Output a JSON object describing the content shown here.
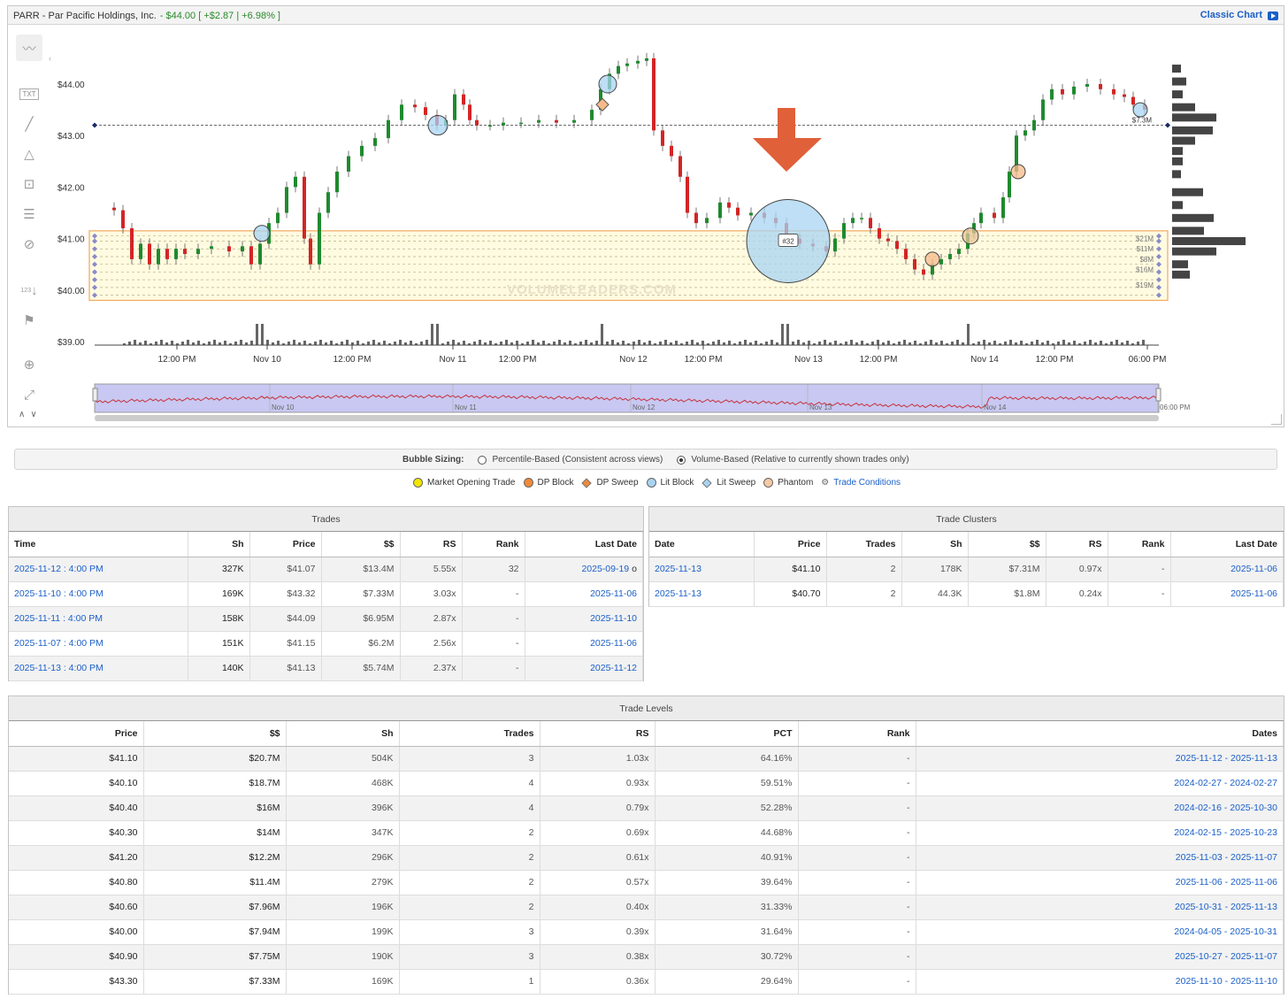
{
  "header": {
    "ticker": "PARR - Par Pacific Holdings, Inc.",
    "price_change": "- $44.00 [ +$2.87 | +6.98% ]",
    "classic_chart": "Classic Chart"
  },
  "toolbar": {
    "tools": [
      "trendline-tool",
      "text-tool",
      "line-tool",
      "fibonacci-tool",
      "rectangle-tool",
      "levels-tool",
      "hide-tool",
      "measure-tool",
      "flag-tool",
      "zoom-tool",
      "fit-tool"
    ],
    "text_tool_label": "TXT",
    "measure_label": "123"
  },
  "chart_data": {
    "type": "candlestick",
    "y_axis_ticks": [
      "$44.00",
      "$43.00",
      "$42.00",
      "$41.00",
      "$40.00",
      "$39.00"
    ],
    "ylim": [
      39.0,
      44.4
    ],
    "x_axis_ticks": [
      "12:00 PM",
      "Nov 10",
      "12:00 PM",
      "Nov 11",
      "12:00 PM",
      "Nov 12",
      "12:00 PM",
      "Nov 13",
      "12:00 PM",
      "Nov 14",
      "12:00 PM",
      "06:00 PM"
    ],
    "navigator_labels": [
      "Nov 10",
      "Nov 11",
      "Nov 12",
      "Nov 13",
      "Nov 14",
      "06:00 PM"
    ],
    "reference_line": {
      "price": 43.2,
      "label": "$7.3M"
    },
    "zone_labels": [
      "$21M",
      "$11M",
      "$8M",
      "$16M",
      "$19M"
    ],
    "bubble_label": "#32",
    "watermark": "VOLUMELEADERS.COM",
    "colors": {
      "up": "#1f8a2e",
      "down": "#d32525",
      "zone": "#fffbe0",
      "zone_border": "#f0a860",
      "arrow": "#e0603a",
      "lit_block": "#a8d4f2",
      "dp_block": "#f6b98a"
    }
  },
  "bubble_sizing": {
    "title": "Bubble Sizing:",
    "option1": "Percentile-Based (Consistent across views)",
    "option2": "Volume-Based (Relative to currently shown trades only)",
    "selected": "option2"
  },
  "legend": [
    {
      "label": "Market Opening Trade",
      "shape": "circle",
      "color": "#f2e600"
    },
    {
      "label": "DP Block",
      "shape": "circle",
      "color": "#f08a3a"
    },
    {
      "label": "DP Sweep",
      "shape": "diamond",
      "color": "#f08a3a"
    },
    {
      "label": "Lit Block",
      "shape": "circle",
      "color": "#a8d4f2"
    },
    {
      "label": "Lit Sweep",
      "shape": "diamond",
      "color": "#a8d4f2"
    },
    {
      "label": "Phantom",
      "shape": "circle",
      "color": "#f7c9a3"
    },
    {
      "label": "Trade Conditions",
      "shape": "gear",
      "color": "#1a5fc8"
    }
  ],
  "trades": {
    "title": "Trades",
    "columns": [
      "Time",
      "Sh",
      "Price",
      "$$",
      "RS",
      "Rank",
      "Last Date"
    ],
    "rows": [
      [
        "2025-11-12 : 4:00 PM",
        "327K",
        "$41.07",
        "$13.4M",
        "5.55x",
        "32",
        "2025-09-19",
        "o"
      ],
      [
        "2025-11-10 : 4:00 PM",
        "169K",
        "$43.32",
        "$7.33M",
        "3.03x",
        "-",
        "2025-11-06",
        ""
      ],
      [
        "2025-11-11 : 4:00 PM",
        "158K",
        "$44.09",
        "$6.95M",
        "2.87x",
        "-",
        "2025-11-10",
        ""
      ],
      [
        "2025-11-07 : 4:00 PM",
        "151K",
        "$41.15",
        "$6.2M",
        "2.56x",
        "-",
        "2025-11-06",
        ""
      ],
      [
        "2025-11-13 : 4:00 PM",
        "140K",
        "$41.13",
        "$5.74M",
        "2.37x",
        "-",
        "2025-11-12",
        ""
      ]
    ]
  },
  "clusters": {
    "title": "Trade Clusters",
    "columns": [
      "Date",
      "Price",
      "Trades",
      "Sh",
      "$$",
      "RS",
      "Rank",
      "Last Date"
    ],
    "rows": [
      [
        "2025-11-13",
        "$41.10",
        "2",
        "178K",
        "$7.31M",
        "0.97x",
        "-",
        "2025-11-06"
      ],
      [
        "2025-11-13",
        "$40.70",
        "2",
        "44.3K",
        "$1.8M",
        "0.24x",
        "-",
        "2025-11-06"
      ]
    ]
  },
  "levels": {
    "title": "Trade Levels",
    "columns": [
      "Price",
      "$$",
      "Sh",
      "Trades",
      "RS",
      "PCT",
      "Rank",
      "Dates"
    ],
    "rows": [
      [
        "$41.10",
        "$20.7M",
        "504K",
        "3",
        "1.03x",
        "64.16%",
        "-",
        "2025-11-12 - 2025-11-13"
      ],
      [
        "$40.10",
        "$18.7M",
        "468K",
        "4",
        "0.93x",
        "59.51%",
        "-",
        "2024-02-27 - 2024-02-27"
      ],
      [
        "$40.40",
        "$16M",
        "396K",
        "4",
        "0.79x",
        "52.28%",
        "-",
        "2024-02-16 - 2025-10-30"
      ],
      [
        "$40.30",
        "$14M",
        "347K",
        "2",
        "0.69x",
        "44.68%",
        "-",
        "2024-02-15 - 2025-10-23"
      ],
      [
        "$41.20",
        "$12.2M",
        "296K",
        "2",
        "0.61x",
        "40.91%",
        "-",
        "2025-11-03 - 2025-11-07"
      ],
      [
        "$40.80",
        "$11.4M",
        "279K",
        "2",
        "0.57x",
        "39.64%",
        "-",
        "2025-11-06 - 2025-11-06"
      ],
      [
        "$40.60",
        "$7.96M",
        "196K",
        "2",
        "0.40x",
        "31.33%",
        "-",
        "2025-10-31 - 2025-11-13"
      ],
      [
        "$40.00",
        "$7.94M",
        "199K",
        "3",
        "0.39x",
        "31.64%",
        "-",
        "2024-04-05 - 2025-10-31"
      ],
      [
        "$40.90",
        "$7.75M",
        "190K",
        "3",
        "0.38x",
        "30.72%",
        "-",
        "2025-10-27 - 2025-11-07"
      ],
      [
        "$43.30",
        "$7.33M",
        "169K",
        "1",
        "0.36x",
        "29.64%",
        "-",
        "2025-11-10 - 2025-11-10"
      ]
    ]
  }
}
